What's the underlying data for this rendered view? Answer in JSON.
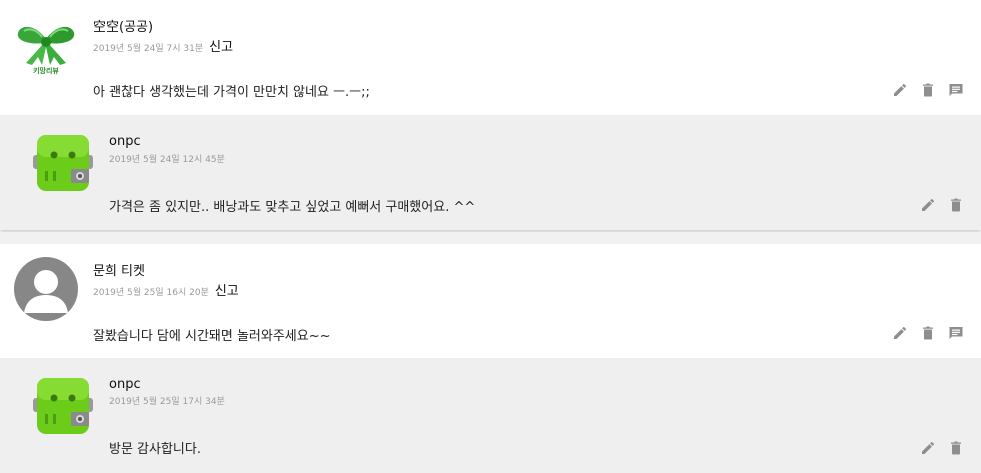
{
  "comments": [
    {
      "author": "空空(공공)",
      "date": "2019년 5월 24일 7시 31분",
      "report": "신고",
      "text": "아 괜찮다 생각했는데 가격이 만만치 않네요 ㅡ.ㅡ;;",
      "avatar_text": "키망리뷰",
      "reply": {
        "author": "onpc",
        "date": "2019년 5월 24일 12시 45분",
        "text": "가격은 좀 있지만.. 배낭과도 맞추고 싶었고 예뻐서 구매했어요. ^^"
      }
    },
    {
      "author": "문희 티켓",
      "date": "2019년 5월 25일 16시 20분",
      "report": "신고",
      "text": "잘봤습니다 담에 시간돼면 놀러와주세요~~",
      "reply": {
        "author": "onpc",
        "date": "2019년 5월 25일 17시 34분",
        "text": "방문 감사합니다."
      }
    }
  ],
  "icons": {
    "edit": "pencil-icon",
    "delete": "trash-icon",
    "reply": "comment-icon"
  },
  "colors": {
    "icon": "#8e8e8e",
    "reply_bg": "#efefef",
    "date": "#9a9a9a"
  }
}
